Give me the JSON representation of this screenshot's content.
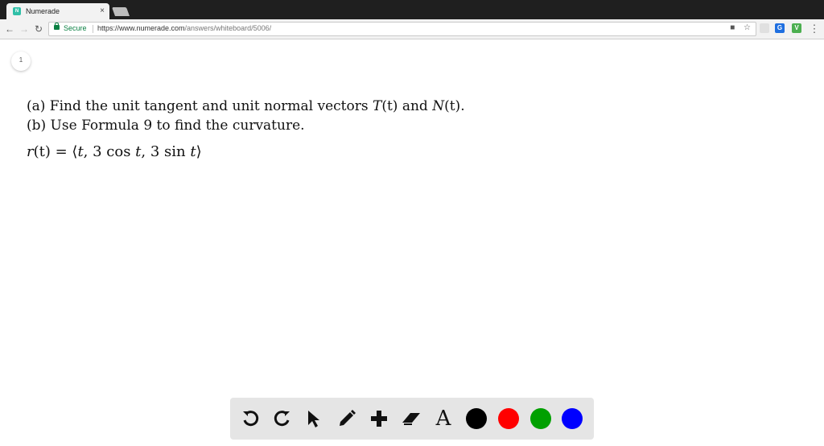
{
  "browser": {
    "tab_title": "Numerade",
    "tab_close": "×",
    "favicon_text": "N",
    "secure_label": "Secure",
    "url_host": "https://www.numerade.com",
    "url_path": "/answers/whiteboard/5006/",
    "extensions": [
      {
        "name": "G",
        "color": "#1f6fe0"
      },
      {
        "name": "V",
        "color": "#4caf50"
      }
    ]
  },
  "page": {
    "page_number": "1",
    "part_a_prefix": "(a) Find the unit tangent and unit normal vectors ",
    "part_a_T": "T",
    "part_a_t1": "(t)",
    "part_a_and": " and ",
    "part_a_N": "N",
    "part_a_t2": "(t).",
    "part_b": "(b) Use Formula 9 to find the curvature.",
    "formula_r": "r",
    "formula_lhs_rest": "(t) = ⟨",
    "formula_t": "t",
    "formula_mid1": ", 3 cos ",
    "formula_t2": "t",
    "formula_mid2": ", 3 sin ",
    "formula_t3": "t",
    "formula_end": "⟩"
  },
  "tools": {
    "text_tool_label": "A",
    "colors": [
      "#000000",
      "#ff0000",
      "#00a000",
      "#0000ff"
    ]
  }
}
